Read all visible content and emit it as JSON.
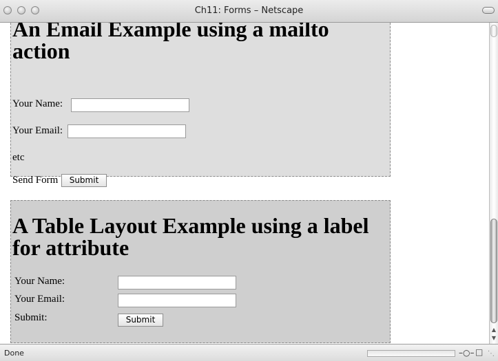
{
  "window": {
    "title": "Ch11: Forms – Netscape"
  },
  "form1": {
    "heading_line1": "An Email Example using a mailto",
    "heading_line2": "action",
    "name_label": "Your Name:",
    "email_label": "Your Email:",
    "etc_text": "etc",
    "send_label": "Send Form",
    "submit_label": "Submit"
  },
  "form2": {
    "heading_line1": "A Table Layout Example using a label",
    "heading_line2": "for attribute",
    "name_label": "Your Name:",
    "email_label": "Your Email:",
    "submit_row_label": "Submit:",
    "submit_label": "Submit"
  },
  "status": {
    "text": "Done"
  },
  "icons": {
    "close": "close-icon",
    "minimize": "minimize-icon",
    "zoom": "zoom-icon",
    "toolbar_toggle": "toolbar-toggle-icon",
    "scroll_up": "scroll-up-icon",
    "scroll_down": "scroll-down-icon",
    "online": "connection-plug-icon",
    "security": "lock-icon",
    "resize": "resize-grip-icon"
  }
}
